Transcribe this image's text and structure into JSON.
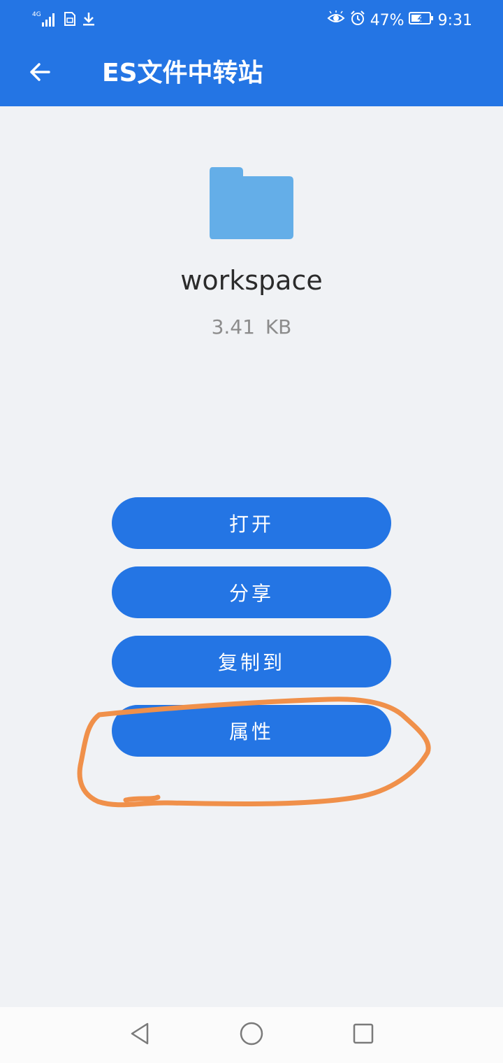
{
  "colors": {
    "primary": "#2475e4",
    "background": "#f0f2f5",
    "folder": "#64aee8",
    "annotation": "#f0904a"
  },
  "status_bar": {
    "network": "4G",
    "battery": "47%",
    "time": "9:31",
    "icons": [
      "signal-icon",
      "sim-card-icon",
      "download-icon",
      "eye-icon",
      "alarm-icon",
      "battery-icon"
    ]
  },
  "app_bar": {
    "back_icon": "arrow-left-icon",
    "title": "ES文件中转站"
  },
  "file": {
    "icon": "folder-icon",
    "name": "workspace",
    "size": "3.41 KB"
  },
  "actions": [
    {
      "label": "打开"
    },
    {
      "label": "分享"
    },
    {
      "label": "复制到"
    },
    {
      "label": "属性"
    }
  ],
  "nav_bar": {
    "icons": [
      "triangle-back-icon",
      "circle-home-icon",
      "square-recent-icon"
    ]
  }
}
